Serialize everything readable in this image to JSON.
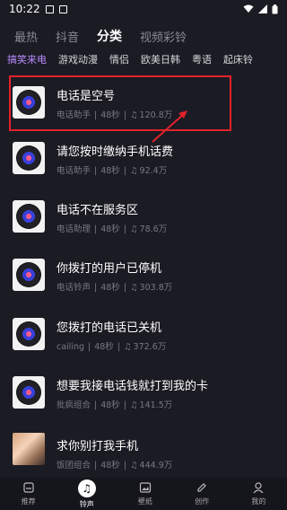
{
  "status": {
    "time": "10:22"
  },
  "top_tabs": [
    "最热",
    "抖音",
    "分类",
    "视频彩铃"
  ],
  "top_active": 2,
  "sub_tabs": [
    "搞笑来电",
    "游戏动漫",
    "情侣",
    "欧美日韩",
    "粤语",
    "起床铃"
  ],
  "sub_active": 0,
  "items": [
    {
      "title": "电话是空号",
      "artist": "电话助手",
      "duration": "48秒",
      "plays": "120.8万"
    },
    {
      "title": "请您按时缴纳手机话费",
      "artist": "电话助手",
      "duration": "48秒",
      "plays": "92.4万"
    },
    {
      "title": "电话不在服务区",
      "artist": "电话助理",
      "duration": "48秒",
      "plays": "78.6万"
    },
    {
      "title": "你拨打的用户已停机",
      "artist": "电话铃声",
      "duration": "48秒",
      "plays": "303.8万"
    },
    {
      "title": "您拨打的电话已关机",
      "artist": "cailing",
      "duration": "48秒",
      "plays": "372.6万"
    },
    {
      "title": "想要我接电话钱就打到我的卡",
      "artist": "批疯组合",
      "duration": "48秒",
      "plays": "141.5万"
    },
    {
      "title": "求你别打我手机",
      "artist": "饭团组合",
      "duration": "48秒",
      "plays": "444.9万"
    }
  ],
  "nav": [
    {
      "label": "推荐",
      "icon": "home-icon"
    },
    {
      "label": "铃声",
      "icon": "music-note-icon"
    },
    {
      "label": "壁纸",
      "icon": "image-icon"
    },
    {
      "label": "创作",
      "icon": "pencil-icon"
    },
    {
      "label": "我的",
      "icon": "user-icon"
    }
  ],
  "colors": {
    "accent": "#b98cff",
    "highlight": "#e0222a",
    "background": "#1b1b23"
  }
}
